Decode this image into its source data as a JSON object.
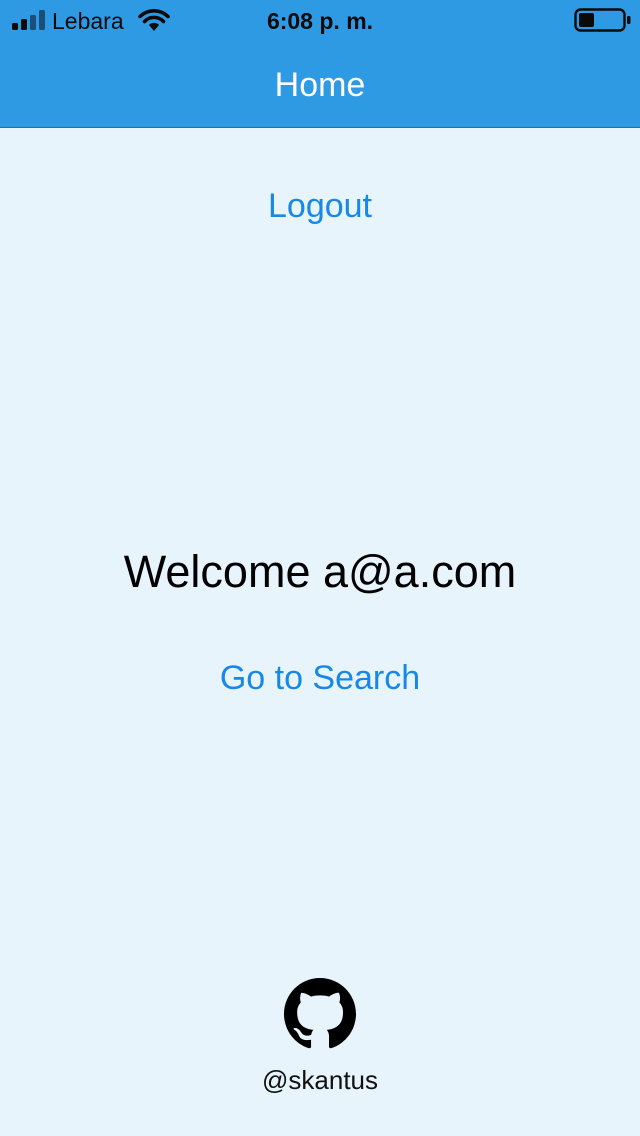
{
  "status_bar": {
    "carrier": "Lebara",
    "time": "6:08 p. m.",
    "signal_icon": "cellular-signal-icon",
    "wifi_icon": "wifi-icon",
    "battery_icon": "battery-icon",
    "battery_level": 0.35
  },
  "nav": {
    "title": "Home"
  },
  "actions": {
    "logout_label": "Logout",
    "search_label": "Go to Search"
  },
  "main": {
    "welcome_text": "Welcome a@a.com"
  },
  "footer": {
    "icon": "github-icon",
    "handle": "@skantus"
  },
  "colors": {
    "header_bg": "#2f9ae4",
    "page_bg": "#e8f4fb",
    "link": "#1888e8"
  }
}
